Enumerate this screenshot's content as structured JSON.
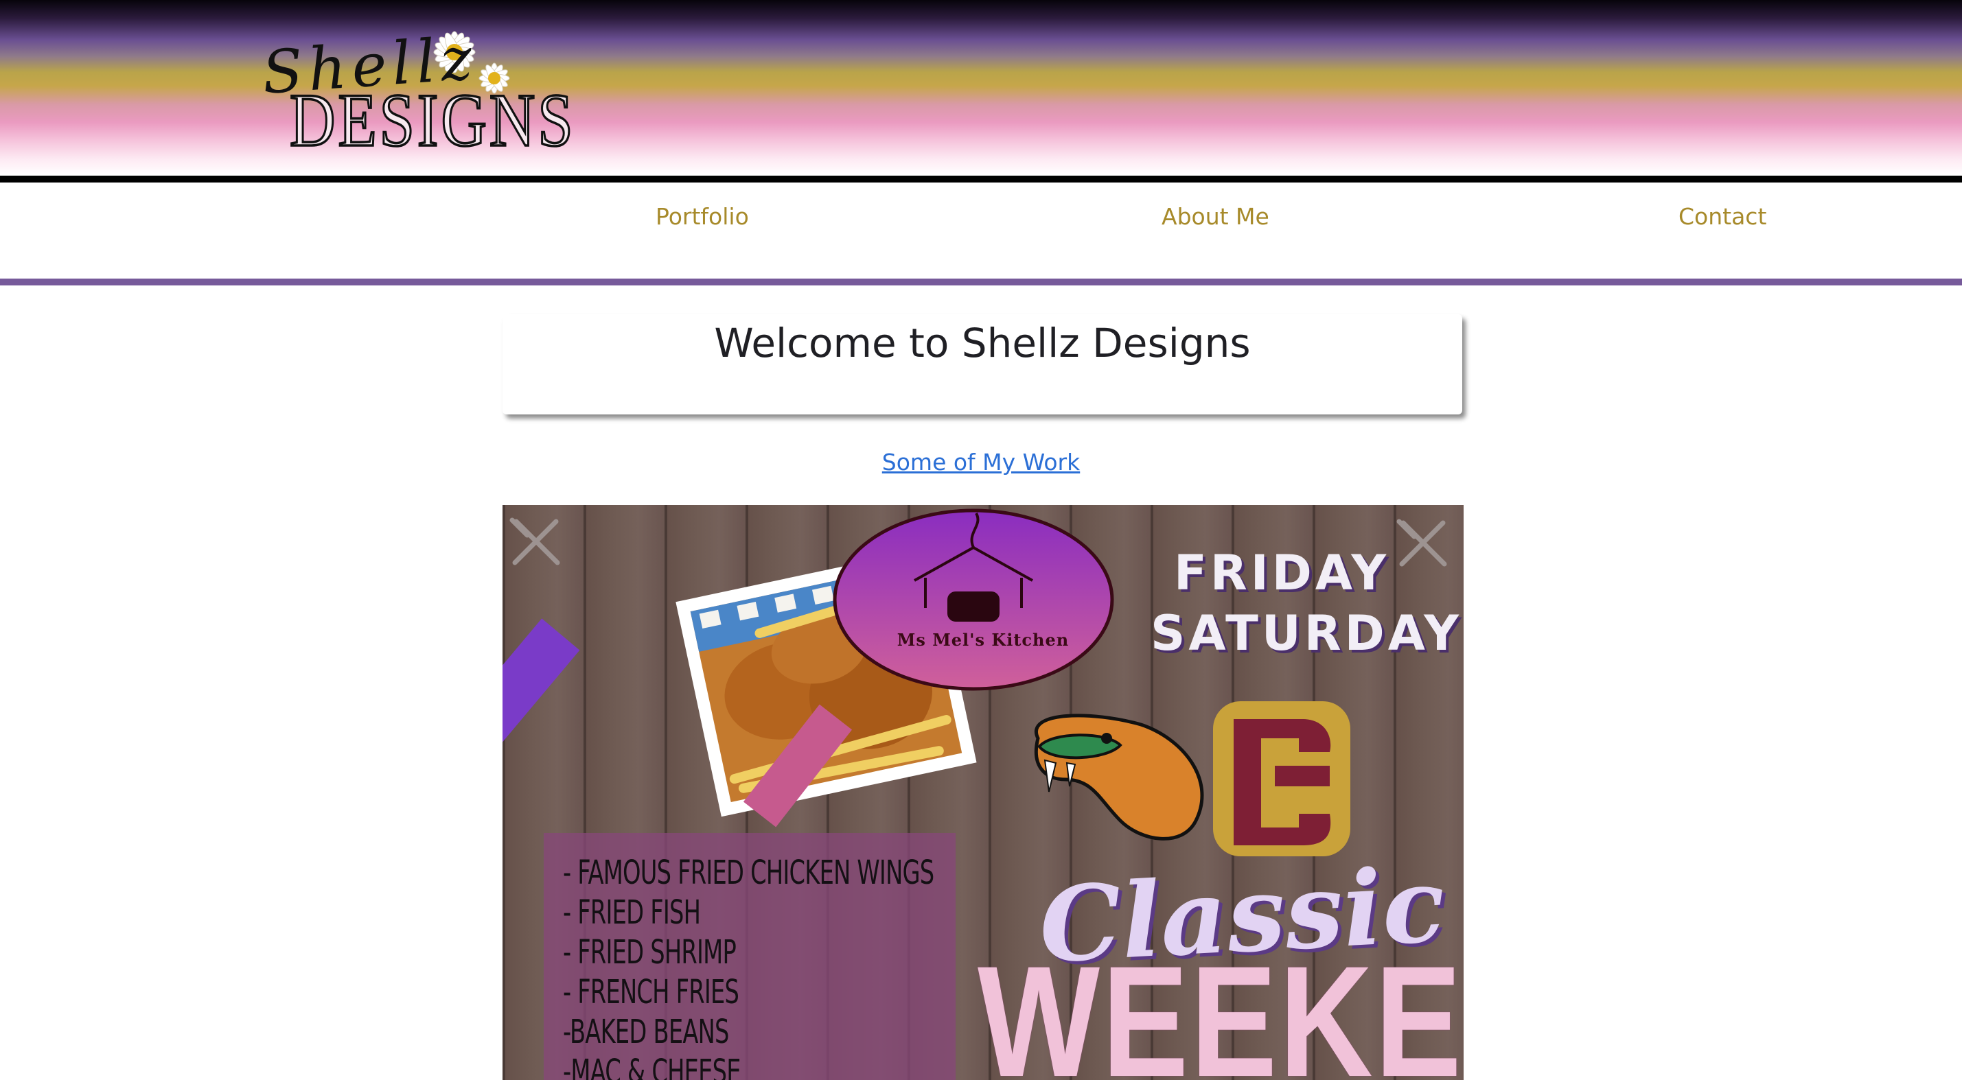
{
  "header": {
    "logo": {
      "script_text": "Shellz",
      "word_text": "DESIGNS"
    },
    "colors": {
      "top": "#07040b",
      "purple": "#6a4f92",
      "gold": "#c6a64a",
      "pink": "#ea9ac0"
    }
  },
  "nav": {
    "items": [
      {
        "label": "Portfolio"
      },
      {
        "label": "About Me"
      },
      {
        "label": "Contact"
      }
    ],
    "link_color": "#a78a2a",
    "rule_color": "#765a9a"
  },
  "main": {
    "welcome_title": "Welcome to Shellz Designs",
    "work_link": "Some of My Work",
    "link_color": "#2b6fd6"
  },
  "flyer": {
    "kitchen_name": "Ms Mel's Kitchen",
    "days": [
      "FRIDAY",
      "SATURDAY"
    ],
    "menu": [
      "- FAMOUS FRIED CHICKEN WINGS",
      "- FRIED FISH",
      "- FRIED SHRIMP",
      "- FRENCH FRIES",
      "-BAKED BEANS",
      "-MAC & CHEESE"
    ],
    "headline_1": "Classic",
    "headline_2": "WEEKEND",
    "icons": [
      "fork-knife-icon",
      "rattler-logo",
      "bc-logo",
      "cooking-pot-icon"
    ]
  }
}
